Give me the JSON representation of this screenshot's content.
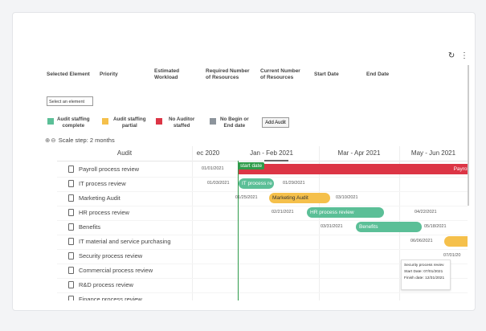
{
  "toolbar": {
    "refresh_icon": "refresh-icon",
    "more_icon": "kebab-icon"
  },
  "header": {
    "selected_element": "Selected Element",
    "priority": "Priority",
    "estimated_workload": "Estimated\nWorkload",
    "required_resources": "Required Number\nof Resources",
    "current_resources": "Current Number\nof Resources",
    "start_date": "Start Date",
    "end_date": "End Date",
    "select_placeholder": "Select an element"
  },
  "legend": [
    {
      "label": "Audit staffing\ncomplete",
      "color": "#5bbf97"
    },
    {
      "label": "Audit staffing\npartial",
      "color": "#f5c04b"
    },
    {
      "label": "No Auditor\nstaffed",
      "color": "#dc3545"
    },
    {
      "label": "No Begin or\nEnd date",
      "color": "#8c949c"
    }
  ],
  "add_audit_label": "Add Audit",
  "scale_label": "Scale step: 2 months",
  "gantt": {
    "column_header": "Audit",
    "periods": [
      "ec 2020",
      "Jan - Feb 2021",
      "Mar - Apr 2021",
      "May - Jun 2021"
    ],
    "today_label": "start date",
    "rows": [
      {
        "name": "Payroll process review"
      },
      {
        "name": "IT process review"
      },
      {
        "name": "Marketing Audit"
      },
      {
        "name": "HR process review"
      },
      {
        "name": "Benefits"
      },
      {
        "name": "IT material and service purchasing"
      },
      {
        "name": "Security process review"
      },
      {
        "name": "Commercial process review"
      },
      {
        "name": "R&D process review"
      },
      {
        "name": "Finance process review"
      }
    ],
    "bars": [
      {
        "row": 0,
        "label": "Payrol",
        "start": "01/01/2021",
        "end": "",
        "color": "#dc3545",
        "text_color": "#fff",
        "align": "right"
      },
      {
        "row": 1,
        "label": "IT process re",
        "start": "01/03/2021",
        "end": "01/29/2021",
        "color": "#5bbf97",
        "text_color": "#fff"
      },
      {
        "row": 2,
        "label": "Marketing Audit",
        "start": "01/25/2021",
        "end": "03/10/2021",
        "color": "#f5c04b",
        "text_color": "#333"
      },
      {
        "row": 3,
        "label": "HR process review",
        "start": "02/21/2021",
        "end": "04/22/2021",
        "color": "#5bbf97",
        "text_color": "#fff"
      },
      {
        "row": 4,
        "label": "Benefits",
        "start": "03/31/2021",
        "end": "05/18/2021",
        "color": "#5bbf97",
        "text_color": "#fff"
      },
      {
        "row": 5,
        "label": "",
        "start": "06/06/2021",
        "end": "",
        "color": "#f5c04b",
        "text_color": "#333"
      },
      {
        "row": 6,
        "label": "",
        "start": "07/01/20",
        "end": "",
        "color": "",
        "text_color": ""
      }
    ],
    "tooltip": {
      "title": "Security process reviev",
      "start": "Start Date: 07/01/2021",
      "finish": "Finish date: 12/31/2021"
    }
  }
}
